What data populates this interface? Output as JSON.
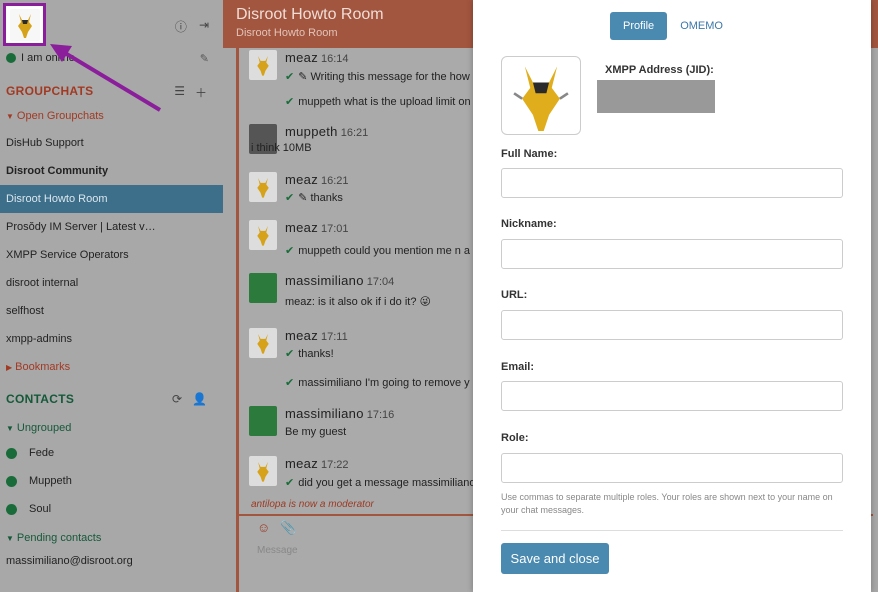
{
  "sidebar": {
    "status_text": "I am online",
    "groupchats_title": "GROUPCHATS",
    "open_groupchats_label": "Open Groupchats",
    "rooms": [
      {
        "label": "DisHub Support",
        "bold": false,
        "active": false
      },
      {
        "label": "Disroot Community",
        "bold": true,
        "active": false
      },
      {
        "label": "Disroot Howto Room",
        "bold": false,
        "active": true
      },
      {
        "label": "Prosŏdy IM Server | Latest v…",
        "bold": false,
        "active": false
      },
      {
        "label": "XMPP Service Operators",
        "bold": false,
        "active": false
      },
      {
        "label": "disroot internal",
        "bold": false,
        "active": false
      },
      {
        "label": "selfhost",
        "bold": false,
        "active": false
      },
      {
        "label": "xmpp-admins",
        "bold": false,
        "active": false
      }
    ],
    "bookmarks_label": "Bookmarks",
    "contacts_title": "CONTACTS",
    "ungrouped_label": "Ungrouped",
    "contacts": [
      "Fede",
      "Muppeth",
      "Soul"
    ],
    "pending_label": "Pending contacts",
    "pending_contacts": [
      "massimiliano@disroot.org"
    ]
  },
  "chat": {
    "title": "Disroot Howto Room",
    "subtitle": "Disroot Howto Room",
    "messages": [
      {
        "author": "meaz",
        "time": "16:14",
        "lines": [
          "✎ Writing this message for the how",
          "muppeth what is the upload limit on c"
        ]
      },
      {
        "author": "muppeth",
        "time": "16:21",
        "lines": [
          "i think 10MB"
        ]
      },
      {
        "author": "meaz",
        "time": "16:21",
        "lines": [
          "✎ thanks"
        ]
      },
      {
        "author": "meaz",
        "time": "17:01",
        "lines": [
          "muppeth could you mention me n a"
        ]
      },
      {
        "author": "massimiliano",
        "time": "17:04",
        "lines": [
          "meaz: is it also ok if i do it? 😜"
        ]
      },
      {
        "author": "meaz",
        "time": "17:11",
        "lines": [
          "thanks!",
          "massimiliano I'm going to remove y"
        ]
      },
      {
        "author": "massimiliano",
        "time": "17:16",
        "lines": [
          "Be my guest"
        ]
      },
      {
        "author": "meaz",
        "time": "17:22",
        "lines": [
          "did you get a message massimiliano"
        ]
      }
    ],
    "notice": "antilopa is now a moderator",
    "input_placeholder": "Message"
  },
  "modal": {
    "tab_profile": "Profile",
    "tab_omemo": "OMEMO",
    "jid_label": "XMPP Address (JID):",
    "full_name_label": "Full Name:",
    "nickname_label": "Nickname:",
    "url_label": "URL:",
    "email_label": "Email:",
    "role_label": "Role:",
    "role_hint": "Use commas to separate multiple roles. Your roles are shown next to your name on your chat messages.",
    "save_label": "Save and close"
  },
  "colors": {
    "chat_accent": "#a2553f",
    "active_room": "#3d6f8a",
    "button_blue": "#4a89b0",
    "online_green": "#196c3a",
    "annotation_purple": "#8b1f9b"
  }
}
